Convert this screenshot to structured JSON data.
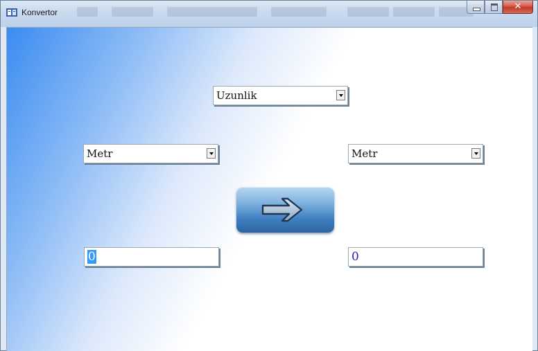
{
  "window": {
    "title": "Konvertor"
  },
  "category_select": {
    "value": "Uzunlik"
  },
  "from_unit_select": {
    "value": "Metr"
  },
  "to_unit_select": {
    "value": "Metr"
  },
  "convert_button": {
    "icon": "arrow-right-icon"
  },
  "input_field": {
    "value": "0"
  },
  "output_field": {
    "value": "0"
  },
  "colors": {
    "gradient_blue": "#3b8cf1",
    "button_blue": "#3f7fc0",
    "text_blue": "#1d1dc8",
    "selection": "#3399ff"
  }
}
